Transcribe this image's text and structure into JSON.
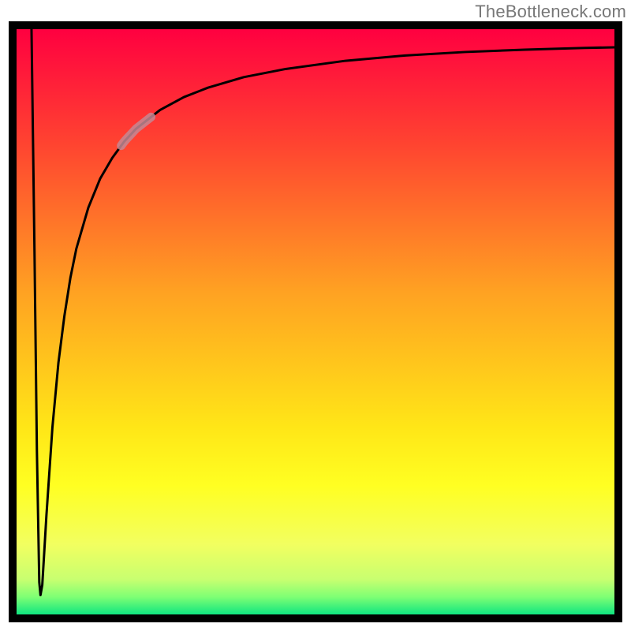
{
  "watermark": "TheBottleneck.com",
  "colors": {
    "frame": "#000000",
    "curve": "#000000",
    "highlight": "#C48894",
    "gradient_stops": [
      {
        "offset": 0.0,
        "color": "#ff0040"
      },
      {
        "offset": 0.2,
        "color": "#ff4530"
      },
      {
        "offset": 0.45,
        "color": "#ffa222"
      },
      {
        "offset": 0.68,
        "color": "#ffe617"
      },
      {
        "offset": 0.78,
        "color": "#ffff22"
      },
      {
        "offset": 0.88,
        "color": "#f2ff60"
      },
      {
        "offset": 0.94,
        "color": "#c8ff70"
      },
      {
        "offset": 0.97,
        "color": "#7fff74"
      },
      {
        "offset": 1.0,
        "color": "#10e580"
      }
    ]
  },
  "chart_data": {
    "type": "line",
    "title": "",
    "xlabel": "",
    "ylabel": "",
    "xlim": [
      0,
      100
    ],
    "ylim": [
      0,
      100
    ],
    "note": "Axes are unlabeled; values are in percent of plot width/height, read from the curve shape. Y=100 means top of plot (near red), Y=0 means bottom (near green).",
    "series": [
      {
        "name": "bottleneck-curve",
        "x": [
          2.5,
          3.0,
          3.4,
          3.8,
          4.0,
          4.3,
          5.0,
          6.0,
          7.0,
          8.0,
          9.0,
          10.0,
          12.0,
          14.0,
          16.0,
          18.0,
          20.0,
          24.0,
          28.0,
          32.0,
          38.0,
          45.0,
          55.0,
          65.0,
          75.0,
          85.0,
          95.0,
          100.0
        ],
        "y": [
          100.0,
          62.0,
          28.0,
          5.5,
          3.3,
          5.0,
          17.0,
          32.0,
          43.0,
          51.0,
          57.5,
          62.5,
          69.5,
          74.5,
          78.0,
          80.8,
          83.0,
          86.2,
          88.4,
          90.0,
          91.8,
          93.2,
          94.6,
          95.5,
          96.1,
          96.5,
          96.8,
          96.9
        ]
      }
    ],
    "highlight_segment": {
      "series": "bottleneck-curve",
      "x_from": 17.5,
      "x_to": 22.5,
      "approximate_y_from": 80.1,
      "approximate_y_to": 84.2
    }
  }
}
